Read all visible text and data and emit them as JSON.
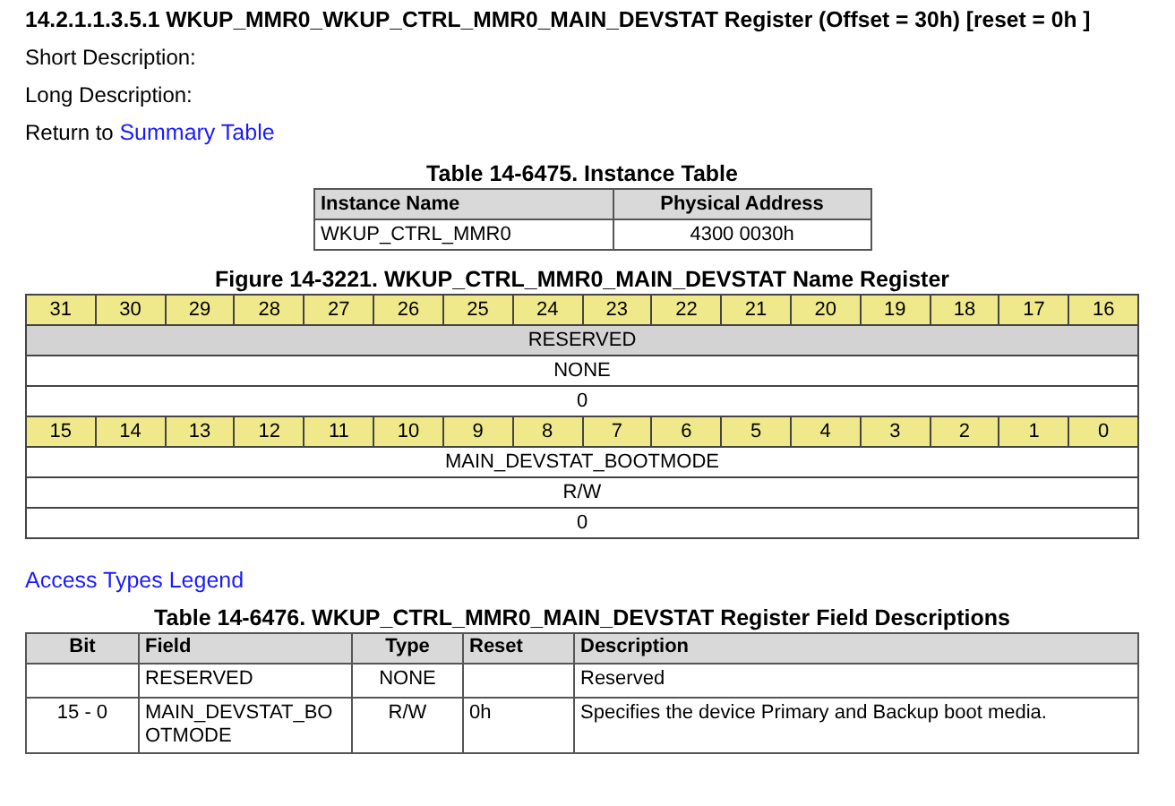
{
  "heading": "14.2.1.1.3.5.1 WKUP_MMR0_WKUP_CTRL_MMR0_MAIN_DEVSTAT Register (Offset = 30h) [reset = 0h ]",
  "short_description": "Short Description:",
  "long_description": "Long Description:",
  "return_link": {
    "prefix": "Return to",
    "link": "Summary Table"
  },
  "instance_table": {
    "caption": "Table 14-6475. Instance Table",
    "columns": [
      "Instance Name",
      "Physical Address"
    ],
    "rows": [
      [
        "WKUP_CTRL_MMR0",
        "4300 0030h"
      ]
    ]
  },
  "register_figure": {
    "caption": "Figure 14-3221. WKUP_CTRL_MMR0_MAIN_DEVSTAT Name Register",
    "rows": [
      {
        "kind": "bits",
        "cells": [
          "31",
          "30",
          "29",
          "28",
          "27",
          "26",
          "25",
          "24",
          "23",
          "22",
          "21",
          "20",
          "19",
          "18",
          "17",
          "16"
        ]
      },
      {
        "kind": "field",
        "text": "RESERVED",
        "reserved": true
      },
      {
        "kind": "access",
        "text": "NONE"
      },
      {
        "kind": "reset",
        "text": "0"
      },
      {
        "kind": "bits",
        "cells": [
          "15",
          "14",
          "13",
          "12",
          "11",
          "10",
          "9",
          "8",
          "7",
          "6",
          "5",
          "4",
          "3",
          "2",
          "1",
          "0"
        ]
      },
      {
        "kind": "field",
        "text": "MAIN_DEVSTAT_BOOTMODE",
        "reserved": false
      },
      {
        "kind": "access",
        "text": "R/W"
      },
      {
        "kind": "reset",
        "text": "0"
      }
    ]
  },
  "legend_link": "Access Types Legend",
  "field_table": {
    "caption": "Table 14-6476. WKUP_CTRL_MMR0_MAIN_DEVSTAT Register Field Descriptions",
    "columns": [
      "Bit",
      "Field",
      "Type",
      "Reset",
      "Description"
    ],
    "rows": [
      [
        "",
        "RESERVED",
        "NONE",
        "",
        "Reserved"
      ],
      [
        "15 - 0",
        "MAIN_DEVSTAT_BOOTMODE",
        "R/W",
        "0h",
        "Specifies the device Primary and Backup boot media."
      ]
    ]
  }
}
